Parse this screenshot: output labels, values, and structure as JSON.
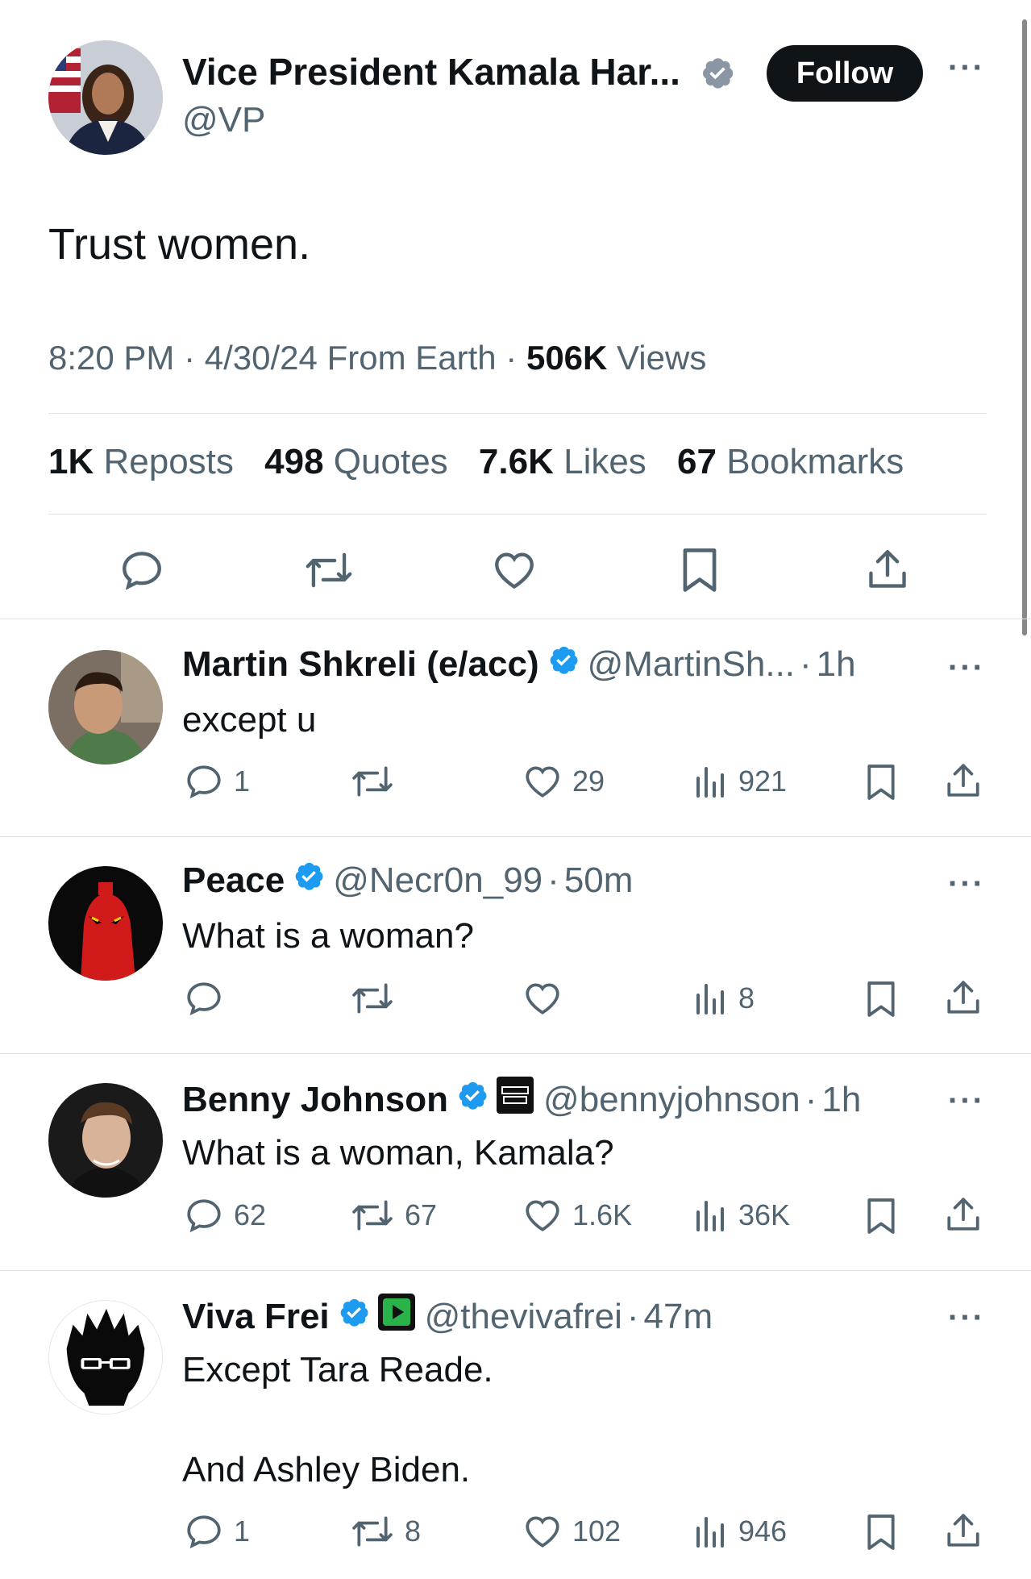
{
  "main_tweet": {
    "name": "Vice President Kamala Har...",
    "handle": "@VP",
    "follow_label": "Follow",
    "more_label": "···",
    "text": "Trust women.",
    "time": "8:20 PM",
    "date": "4/30/24",
    "source": "From Earth",
    "views_count": "506K",
    "views_label": "Views",
    "stats": [
      {
        "count": "1K",
        "label": "Reposts"
      },
      {
        "count": "498",
        "label": "Quotes"
      },
      {
        "count": "7.6K",
        "label": "Likes"
      },
      {
        "count": "67",
        "label": "Bookmarks"
      }
    ],
    "actions": [
      "reply-icon",
      "repost-icon",
      "like-icon",
      "bookmark-icon",
      "share-icon"
    ]
  },
  "replies": [
    {
      "name": "Martin Shkreli (e/acc)",
      "handle": "@MartinSh...",
      "time": "1h",
      "text": "except u",
      "reply_count": "1",
      "repost_count": "",
      "like_count": "29",
      "view_count": "921"
    },
    {
      "name": "Peace",
      "handle": "@Necr0n_99",
      "time": "50m",
      "text": "What is a woman?",
      "reply_count": "",
      "repost_count": "",
      "like_count": "",
      "view_count": "8"
    },
    {
      "name": "Benny Johnson",
      "handle": "@bennyjohnson",
      "time": "1h",
      "text": "What is a woman, Kamala?",
      "reply_count": "62",
      "repost_count": "67",
      "like_count": "1.6K",
      "view_count": "36K"
    },
    {
      "name": "Viva Frei",
      "handle": "@thevivafrei",
      "time": "47m",
      "text": "Except Tara Reade.",
      "text2": "And Ashley Biden.",
      "reply_count": "1",
      "repost_count": "8",
      "like_count": "102",
      "view_count": "946"
    }
  ],
  "colors": {
    "verified": "#1d9bf0",
    "text": "#0f1419",
    "muted": "#536471",
    "divider": "#dfe3e6"
  },
  "separator": "·"
}
